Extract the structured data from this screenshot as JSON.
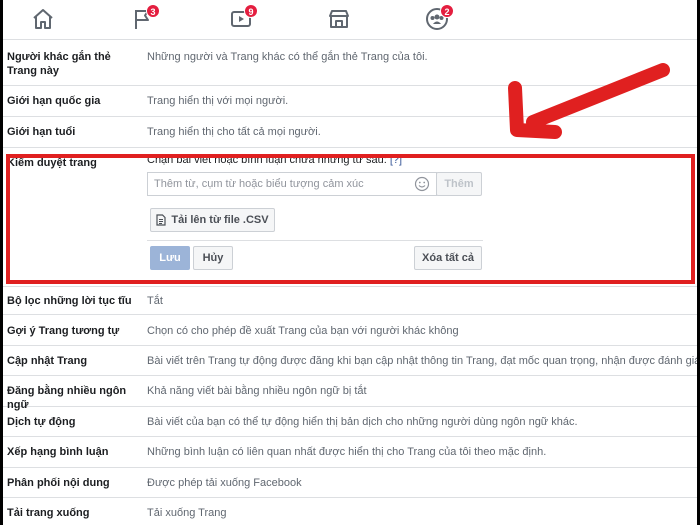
{
  "nav": {
    "items": [
      {
        "icon": "home-icon",
        "badge": ""
      },
      {
        "icon": "flag-icon",
        "badge": "3"
      },
      {
        "icon": "video-icon",
        "badge": "9"
      },
      {
        "icon": "marketplace-icon",
        "badge": ""
      },
      {
        "icon": "groups-icon",
        "badge": "2"
      }
    ]
  },
  "settings": {
    "rows": [
      {
        "label": "Người khác gắn thẻ Trang này",
        "value": "Những người và Trang khác có thể gắn thẻ Trang của tôi."
      },
      {
        "label": "Giới hạn quốc gia",
        "value": "Trang hiển thị với mọi người."
      },
      {
        "label": "Giới hạn tuổi",
        "value": "Trang hiển thị cho tất cả mọi người."
      },
      {
        "label": "Kiểm duyệt trang",
        "value": ""
      },
      {
        "label": "Bộ lọc những lời tục tĩu",
        "value": "Tắt"
      },
      {
        "label": "Gợi ý Trang tương tự",
        "value": "Chọn có cho phép đề xuất Trang của bạn với người khác không"
      },
      {
        "label": "Cập nhật Trang",
        "value": "Bài viết trên Trang tự động được đăng khi bạn cập nhật thông tin Trang, đạt mốc quan trọng, nhận được đánh giá và v.v."
      },
      {
        "label": "Đăng bằng nhiều ngôn ngữ",
        "value": "Khả năng viết bài bằng nhiều ngôn ngữ bị tắt"
      },
      {
        "label": "Dịch tự động",
        "value": "Bài viết của bạn có thể tự động hiển thị bản dịch cho những người dùng ngôn ngữ khác."
      },
      {
        "label": "Xếp hạng bình luận",
        "value": "Những bình luận có liên quan nhất được hiển thị cho Trang của tôi theo mặc định."
      },
      {
        "label": "Phân phối nội dung",
        "value": "Được phép tải xuống Facebook"
      },
      {
        "label": "Tải trang xuống",
        "value": "Tải xuống Trang"
      }
    ]
  },
  "moderation": {
    "description": "Chặn bài viết hoặc bình luận chứa những từ sau:",
    "help": "[?]",
    "input_placeholder": "Thêm từ, cụm từ hoặc biểu tượng cảm xúc",
    "add_label": "Thêm",
    "upload_label": "Tải lên từ file .CSV",
    "save_label": "Lưu",
    "cancel_label": "Hủy",
    "clear_label": "Xóa tất cả"
  },
  "colors": {
    "highlight": "#e02020",
    "badge": "#e41e3f",
    "save_button": "#9cb4d8"
  }
}
